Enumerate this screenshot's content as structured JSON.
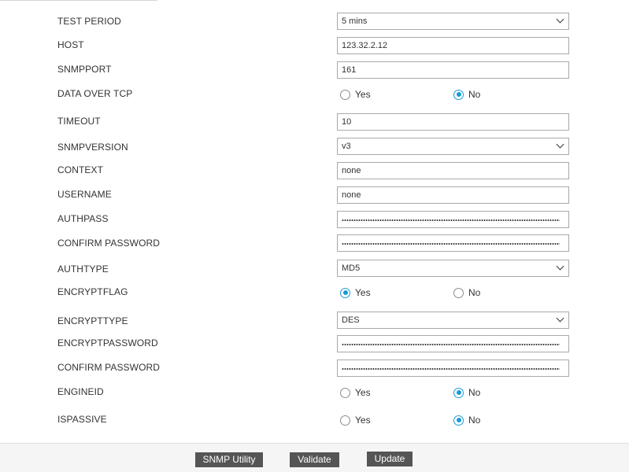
{
  "form": {
    "test_period": {
      "label": "TEST PERIOD",
      "value": "5 mins"
    },
    "host": {
      "label": "HOST",
      "value": "123.32.2.12"
    },
    "snmpport": {
      "label": "SNMPPORT",
      "value": "161"
    },
    "data_over_tcp": {
      "label": "DATA OVER TCP",
      "yes": "Yes",
      "no": "No",
      "selected": "No"
    },
    "timeout": {
      "label": "TIMEOUT",
      "value": "10"
    },
    "snmpversion": {
      "label": "SNMPVERSION",
      "value": "v3"
    },
    "context": {
      "label": "CONTEXT",
      "value": "none"
    },
    "username": {
      "label": "USERNAME",
      "value": "none"
    },
    "authpass": {
      "label": "AUTHPASS"
    },
    "confirm_password_1": {
      "label": "CONFIRM PASSWORD"
    },
    "authtype": {
      "label": "AUTHTYPE",
      "value": "MD5"
    },
    "encryptflag": {
      "label": "ENCRYPTFLAG",
      "yes": "Yes",
      "no": "No",
      "selected": "Yes"
    },
    "encrypttype": {
      "label": "ENCRYPTTYPE",
      "value": "DES"
    },
    "encryptpassword": {
      "label": "ENCRYPTPASSWORD"
    },
    "confirm_password_2": {
      "label": "CONFIRM PASSWORD"
    },
    "engineid": {
      "label": "ENGINEID",
      "yes": "Yes",
      "no": "No",
      "selected": "No"
    },
    "ispassive": {
      "label": "ISPASSIVE",
      "yes": "Yes",
      "no": "No",
      "selected": "No"
    }
  },
  "footer": {
    "snmp_utility": "SNMP Utility",
    "validate": "Validate",
    "update": "Update"
  },
  "colors": {
    "accent": "#1a9ad6",
    "button_bg": "#555555"
  }
}
